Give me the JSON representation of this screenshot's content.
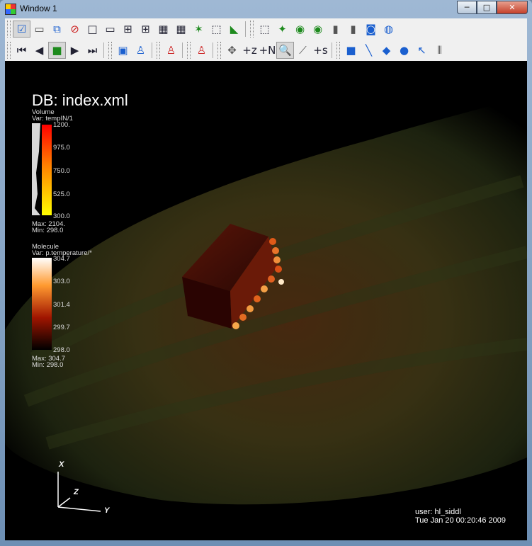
{
  "window": {
    "title": "Window 1",
    "min": "─",
    "max": "□",
    "close": "✕"
  },
  "toolbar1": [
    {
      "name": "select-icon",
      "glyph": "☑",
      "cls": "ic-blue",
      "active": true
    },
    {
      "name": "new-window-icon",
      "glyph": "▭",
      "cls": "ic-gray"
    },
    {
      "name": "copy-window-icon",
      "glyph": "⧉",
      "cls": "ic-blue"
    },
    {
      "name": "clear-window-icon",
      "glyph": "⊘",
      "cls": "ic-red"
    },
    {
      "name": "layout-1x1-icon",
      "glyph": "□",
      "cls": ""
    },
    {
      "name": "layout-1x2-icon",
      "glyph": "▭",
      "cls": ""
    },
    {
      "name": "layout-2x2-icon",
      "glyph": "⊞",
      "cls": ""
    },
    {
      "name": "layout-2x3-icon",
      "glyph": "⊞",
      "cls": ""
    },
    {
      "name": "layout-3x2-icon",
      "glyph": "▦",
      "cls": ""
    },
    {
      "name": "layout-3x3-icon",
      "glyph": "▦",
      "cls": ""
    },
    {
      "name": "spin-icon",
      "glyph": "✶",
      "cls": "ic-green"
    },
    {
      "name": "view-box-icon",
      "glyph": "⬚",
      "cls": ""
    },
    {
      "name": "lock-view-icon",
      "glyph": "◣",
      "cls": "ic-green"
    },
    {
      "name": "perspective-icon",
      "glyph": "⬚",
      "cls": ""
    },
    {
      "name": "reset-view-icon",
      "glyph": "✦",
      "cls": "ic-green"
    },
    {
      "name": "recenter-icon",
      "glyph": "◉",
      "cls": "ic-green"
    },
    {
      "name": "undo-view-icon",
      "glyph": "◉",
      "cls": "ic-green"
    },
    {
      "name": "save-view-icon",
      "glyph": "▮",
      "cls": "ic-gray"
    },
    {
      "name": "choose-view-icon",
      "glyph": "▮",
      "cls": "ic-gray"
    },
    {
      "name": "camera-icon",
      "glyph": "◙",
      "cls": "ic-blue"
    },
    {
      "name": "globe-icon",
      "glyph": "◍",
      "cls": "ic-blue"
    }
  ],
  "toolbar2": [
    {
      "name": "first-frame-icon",
      "glyph": "⏮",
      "cls": ""
    },
    {
      "name": "previous-frame-icon",
      "glyph": "◀",
      "cls": ""
    },
    {
      "name": "stop-icon",
      "glyph": "■",
      "cls": "ic-green",
      "active": true
    },
    {
      "name": "play-icon",
      "glyph": "▶",
      "cls": ""
    },
    {
      "name": "next-frame-icon",
      "glyph": "⏭",
      "cls": ""
    },
    {
      "name": "animation-icon",
      "glyph": "▣",
      "cls": "ic-blue"
    },
    {
      "name": "pick-icon",
      "glyph": "♙",
      "cls": "ic-blue"
    },
    {
      "name": "pick-time-icon",
      "glyph": "♙",
      "cls": "ic-red"
    },
    {
      "name": "lineout-icon",
      "glyph": "♙",
      "cls": "ic-red"
    },
    {
      "name": "navigate-icon",
      "glyph": "✥",
      "cls": "ic-gray"
    },
    {
      "name": "add-zone-icon",
      "glyph": "+z",
      "cls": ""
    },
    {
      "name": "add-node-icon",
      "glyph": "+N",
      "cls": ""
    },
    {
      "name": "zoom-icon",
      "glyph": "🔍",
      "cls": "",
      "active": true
    },
    {
      "name": "curve-icon",
      "glyph": "⟋",
      "cls": "ic-gray"
    },
    {
      "name": "add-sample-icon",
      "glyph": "+s",
      "cls": ""
    },
    {
      "name": "box-tool-icon",
      "glyph": "■",
      "cls": "ic-blue"
    },
    {
      "name": "line-tool-icon",
      "glyph": "╲",
      "cls": "ic-blue"
    },
    {
      "name": "plane-tool-icon",
      "glyph": "◆",
      "cls": "ic-blue"
    },
    {
      "name": "sphere-tool-icon",
      "glyph": "●",
      "cls": "ic-blue"
    },
    {
      "name": "point-tool-icon",
      "glyph": "↖",
      "cls": "ic-blue"
    },
    {
      "name": "axis-tool-icon",
      "glyph": "⫴",
      "cls": "ic-gray"
    }
  ],
  "viewport": {
    "db_label": "DB: index.xml",
    "volume_legend": {
      "title": "Volume",
      "var": "Var: tempIN/1",
      "ticks": [
        "1200.",
        "975.0",
        "750.0",
        "525.0",
        "300.0"
      ],
      "max": "Max:  2104.",
      "min": "Min:  298.0",
      "colors": [
        "#ff0000",
        "#ff8000",
        "#ffff00"
      ]
    },
    "molecule_legend": {
      "title": "Molecule",
      "var": "Var: p.temperature/*",
      "ticks": [
        "304.7",
        "303.0",
        "301.4",
        "299.7",
        "298.0"
      ],
      "max": "Max:  304.7",
      "min": "Min:  298.0",
      "colors": [
        "#ffffff",
        "#ff9a30",
        "#a01500",
        "#000000"
      ]
    },
    "axes": {
      "x": "X",
      "y": "Y",
      "z": "Z"
    },
    "user": "user: hl_siddl",
    "timestamp": "Tue Jan 20 00:20:46 2009"
  }
}
